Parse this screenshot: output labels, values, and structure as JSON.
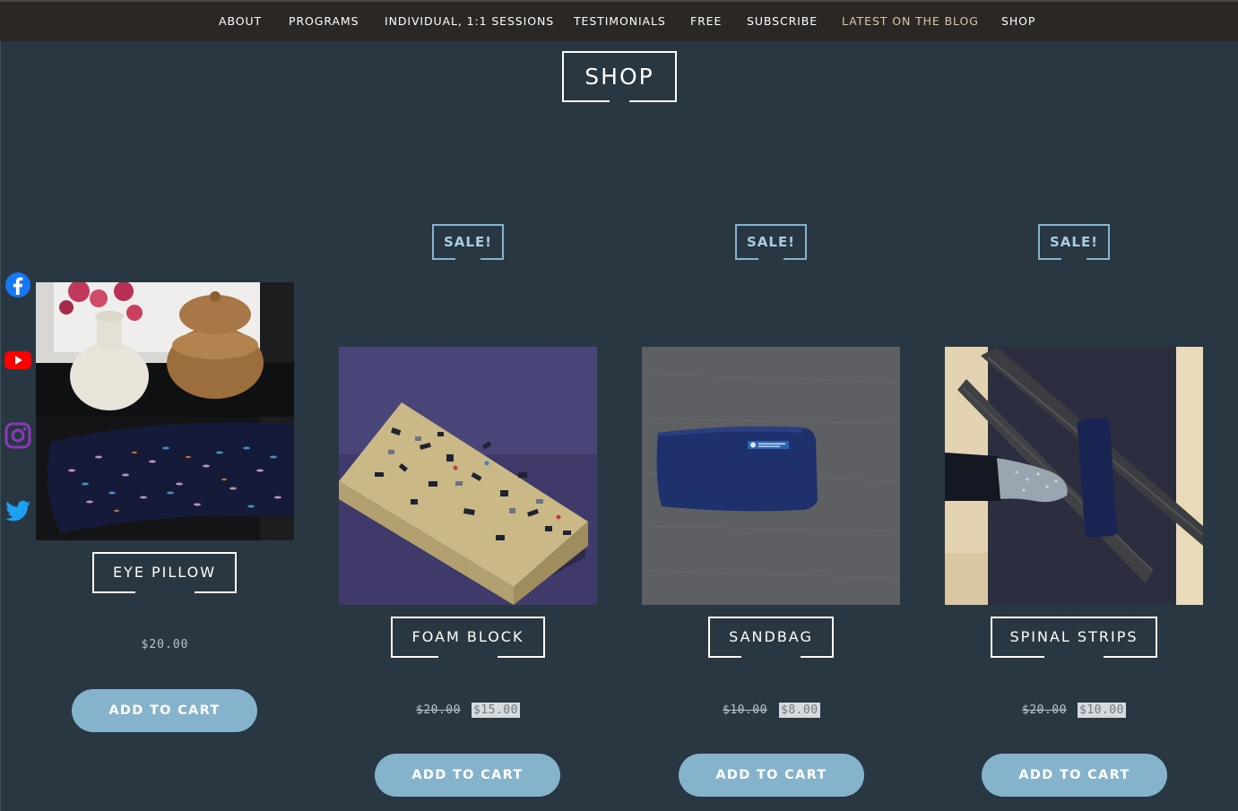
{
  "nav": {
    "items": [
      {
        "label": "ABOUT"
      },
      {
        "label": "PROGRAMS"
      },
      {
        "label": "INDIVIDUAL, 1:1 SESSIONS"
      },
      {
        "label": "TESTIMONIALS"
      },
      {
        "label": "FREE"
      },
      {
        "label": "SUBSCRIBE"
      },
      {
        "label": "LATEST ON THE BLOG"
      },
      {
        "label": "SHOP"
      }
    ]
  },
  "page": {
    "title": "SHOP"
  },
  "social": [
    "facebook-icon",
    "youtube-icon",
    "instagram-icon",
    "twitter-icon"
  ],
  "colors": {
    "background": "#283741",
    "nav_bg": "#2a2724",
    "accent": "#85b3cc",
    "sale_border": "#86b4cf"
  },
  "products": [
    {
      "name": "EYE PILLOW",
      "price": "$20.00",
      "button": "ADD TO CART"
    },
    {
      "name": "FOAM BLOCK",
      "badge": "SALE!",
      "old_price": "$20.00",
      "new_price": "$15.00",
      "button": "ADD TO CART"
    },
    {
      "name": "SANDBAG",
      "badge": "SALE!",
      "old_price": "$10.00",
      "new_price": "$8.00",
      "button": "ADD TO CART"
    },
    {
      "name": "SPINAL STRIPS",
      "badge": "SALE!",
      "old_price": "$20.00",
      "new_price": "$10.00",
      "button": "ADD TO CART"
    }
  ]
}
